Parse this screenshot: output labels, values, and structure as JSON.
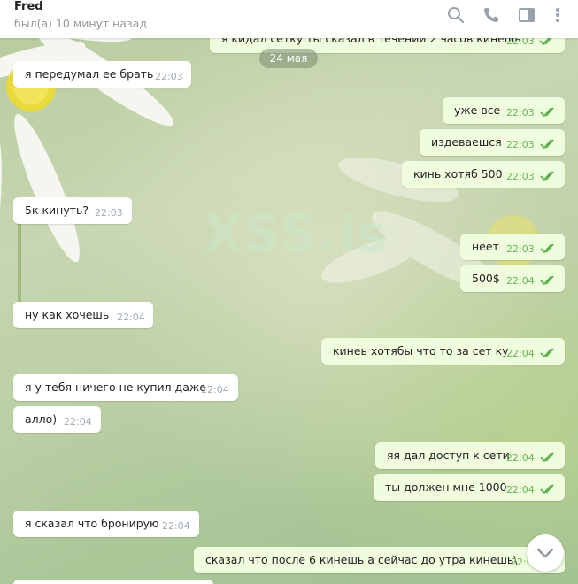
{
  "chat": {
    "name": "Fred",
    "status": "был(а) 10 минут назад"
  },
  "header_icons": [
    "search-icon",
    "phone-icon",
    "sidebar-toggle-icon",
    "more-vert-icon"
  ],
  "watermark": "XSS.is",
  "date_badge": "24 мая",
  "messages": [
    {
      "dir": "out",
      "text": "я кидал сетку ты сказал в течении 2 часов кинешь",
      "time": "22:03",
      "read": true
    },
    {
      "dir": "in",
      "text": "я передумал ее брать",
      "time": "22:03"
    },
    {
      "dir": "out",
      "text": "уже все",
      "time": "22:03",
      "read": true
    },
    {
      "dir": "out",
      "text": "издеваешся",
      "time": "22:03",
      "read": true
    },
    {
      "dir": "out",
      "text": "кинь хотяб 500",
      "time": "22:03",
      "read": true
    },
    {
      "dir": "in",
      "text": "5к кинуть?",
      "time": "22:03"
    },
    {
      "dir": "out",
      "text": "неет",
      "time": "22:03",
      "read": true
    },
    {
      "dir": "out",
      "text": "500$",
      "time": "22:04",
      "read": true
    },
    {
      "dir": "in",
      "text": "ну как хочешь",
      "time": "22:04"
    },
    {
      "dir": "out",
      "text": "кинеь хотябы что то за сет ку",
      "time": "22:04",
      "read": true
    },
    {
      "dir": "in",
      "text": "я у тебя ничего не купил даже",
      "time": "22:04"
    },
    {
      "dir": "in",
      "text": "алло)",
      "time": "22:04"
    },
    {
      "dir": "out",
      "text": "яя дал доступ к сети",
      "time": "22:04",
      "read": true
    },
    {
      "dir": "out",
      "text": "ты должен мне 1000",
      "time": "22:04",
      "read": true
    },
    {
      "dir": "in",
      "text": "я сказал что бронирую",
      "time": "22:04"
    },
    {
      "dir": "out",
      "text": "сказал что после 6 кинешь а сейчас до утра кинешь\\",
      "time": "22:05",
      "read": true
    }
  ],
  "colors": {
    "incoming_bubble": "#ffffff",
    "outgoing_bubble": "#effdde",
    "outgoing_time": "#6cb35a",
    "read_check": "#5fb04e",
    "header_icon": "#9aa3ab"
  }
}
